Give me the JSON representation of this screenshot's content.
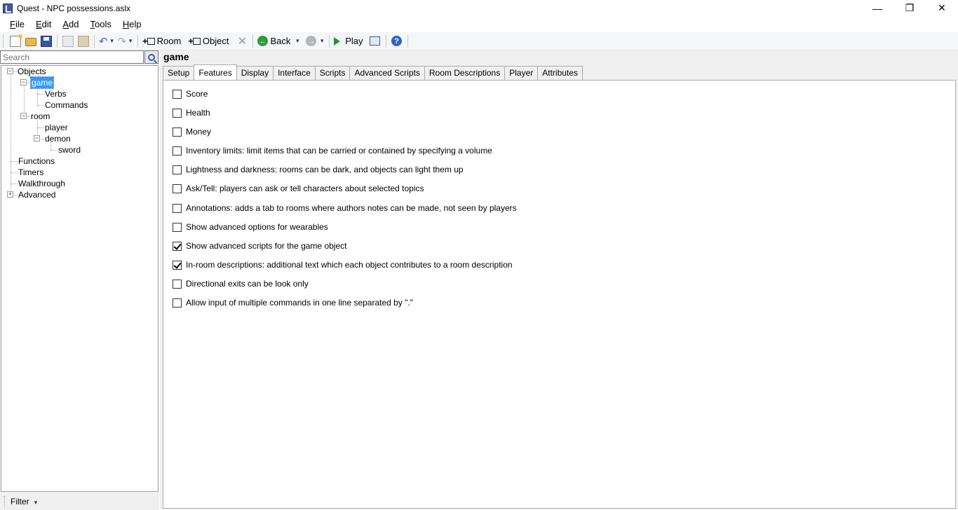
{
  "window": {
    "title": "Quest - NPC possessions.aslx"
  },
  "menu": [
    {
      "key": "F",
      "rest": "ile"
    },
    {
      "key": "E",
      "rest": "dit"
    },
    {
      "key": "A",
      "rest": "dd"
    },
    {
      "key": "T",
      "rest": "ools"
    },
    {
      "key": "H",
      "rest": "elp"
    }
  ],
  "toolbar": {
    "room_label": "Room",
    "object_label": "Object",
    "back_label": "Back",
    "play_label": "Play"
  },
  "sidebar": {
    "search_placeholder": "Search",
    "filter_label": "Filter",
    "tree": {
      "objects": "Objects",
      "game": "game",
      "verbs": "Verbs",
      "commands": "Commands",
      "room": "room",
      "player": "player",
      "demon": "demon",
      "sword": "sword",
      "functions": "Functions",
      "timers": "Timers",
      "walkthrough": "Walkthrough",
      "advanced": "Advanced"
    }
  },
  "main": {
    "title": "game",
    "tabs": [
      "Setup",
      "Features",
      "Display",
      "Interface",
      "Scripts",
      "Advanced Scripts",
      "Room Descriptions",
      "Player",
      "Attributes"
    ],
    "active_tab": "Features",
    "options": [
      {
        "label": "Score",
        "checked": false
      },
      {
        "label": "Health",
        "checked": false
      },
      {
        "label": "Money",
        "checked": false
      },
      {
        "label": "Inventory limits: limit items that can be carried or contained by specifying a volume",
        "checked": false
      },
      {
        "label": "Lightness and darkness: rooms can be dark, and objects can light them up",
        "checked": false
      },
      {
        "label": "Ask/Tell: players can ask or tell characters about selected topics",
        "checked": false
      },
      {
        "label": "Annotations: adds a tab to rooms where authors notes can be made, not seen by players",
        "checked": false
      },
      {
        "label": "Show advanced options for wearables",
        "checked": false
      },
      {
        "label": "Show advanced scripts for the game object",
        "checked": true
      },
      {
        "label": "In-room descriptions: additional text which each object contributes to a room description",
        "checked": true
      },
      {
        "label": "Directional exits can be look only",
        "checked": false
      },
      {
        "label": "Allow input of multiple commands in one line separated by \".\"",
        "checked": false
      }
    ]
  }
}
